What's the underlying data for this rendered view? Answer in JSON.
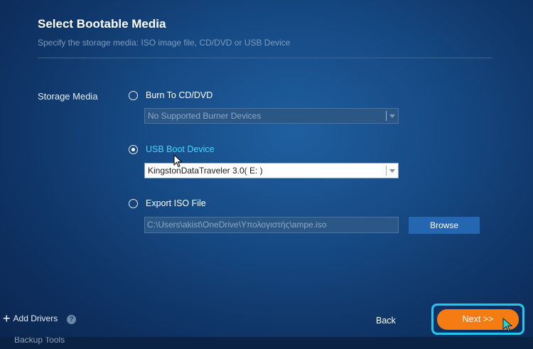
{
  "header": {
    "title": "Select Bootable Media",
    "subtitle": "Specify the storage media: ISO image file, CD/DVD or USB Device"
  },
  "storage": {
    "label": "Storage Media",
    "options": [
      {
        "label": "Burn To CD/DVD",
        "selected": false,
        "select_value": "No Supported Burner Devices",
        "enabled": false
      },
      {
        "label": "USB Boot Device",
        "selected": true,
        "select_value": "KingstonDataTraveler 3.0( E: )",
        "enabled": true
      },
      {
        "label": "Export ISO File",
        "selected": false
      }
    ],
    "iso_path": "C:\\Users\\akist\\OneDrive\\Υπολογιστής\\ampe.iso",
    "browse_label": "Browse"
  },
  "footer": {
    "add_drivers": "Add Drivers",
    "help": "?",
    "back": "Back",
    "next": "Next >>",
    "partial_tab": "Backup Tools"
  },
  "colors": {
    "accent_next": "#f47c13",
    "highlight": "#1ec8f0",
    "active_label": "#3fd9ff"
  }
}
